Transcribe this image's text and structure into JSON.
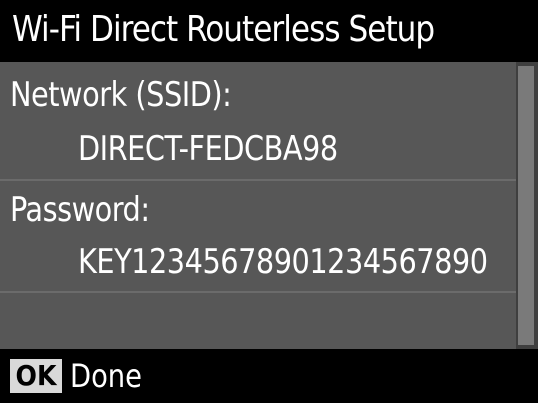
{
  "screen": {
    "title": "Wi-Fi Direct Routerless Setup"
  },
  "network": {
    "label": "Network (SSID):",
    "value": "DIRECT-FEDCBA98"
  },
  "password": {
    "label": "Password:",
    "value": "KEY12345678901234567890"
  },
  "footer": {
    "ok_key": "OK",
    "action_label": "Done"
  },
  "colors": {
    "background": "#000000",
    "panel": "#575757",
    "text": "#ffffff",
    "key_bg": "#d9d9d9"
  }
}
